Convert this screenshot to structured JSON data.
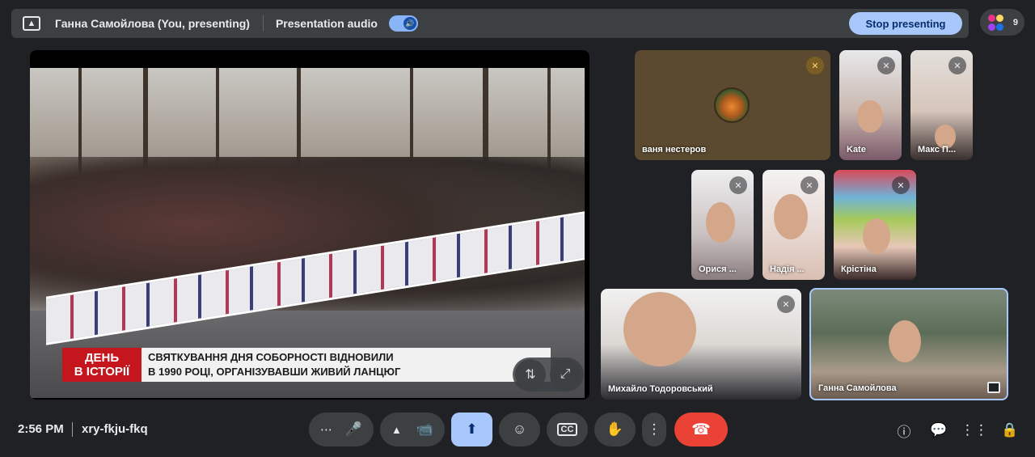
{
  "topbar": {
    "presenter": "Ганна Самойлова (You, presenting)",
    "audio_label": "Presentation audio",
    "stop_label": "Stop presenting",
    "audio_on": true
  },
  "participants_count": "9",
  "main_video": {
    "ticker_red_line1": "ДЕНЬ",
    "ticker_red_line2": "В ІСТОРІЇ",
    "ticker_text_line1": "СВЯТКУВАННЯ ДНЯ СОБОРНОСТІ ВІДНОВИЛИ",
    "ticker_text_line2": "В 1990 РОЦІ, ОРГАНІЗУВАВШИ ЖИВИЙ ЛАНЦЮГ"
  },
  "tiles": [
    {
      "name": "ваня нестеров",
      "muted": true
    },
    {
      "name": "Kate",
      "muted": true
    },
    {
      "name": "Макс П...",
      "muted": true
    },
    {
      "name": "Орися ...",
      "muted": true
    },
    {
      "name": "Надія ...",
      "muted": true
    },
    {
      "name": "Крістіна",
      "muted": true
    },
    {
      "name": "Михайло Тодоровський",
      "muted": true
    },
    {
      "name": "Ганна Самойлова",
      "muted": false
    }
  ],
  "bottom": {
    "time": "2:56 PM",
    "meeting_code": "xry-fkju-fkq"
  },
  "colors": {
    "background": "#202124",
    "accent": "#a8c7fa",
    "end_call": "#ea4335"
  }
}
